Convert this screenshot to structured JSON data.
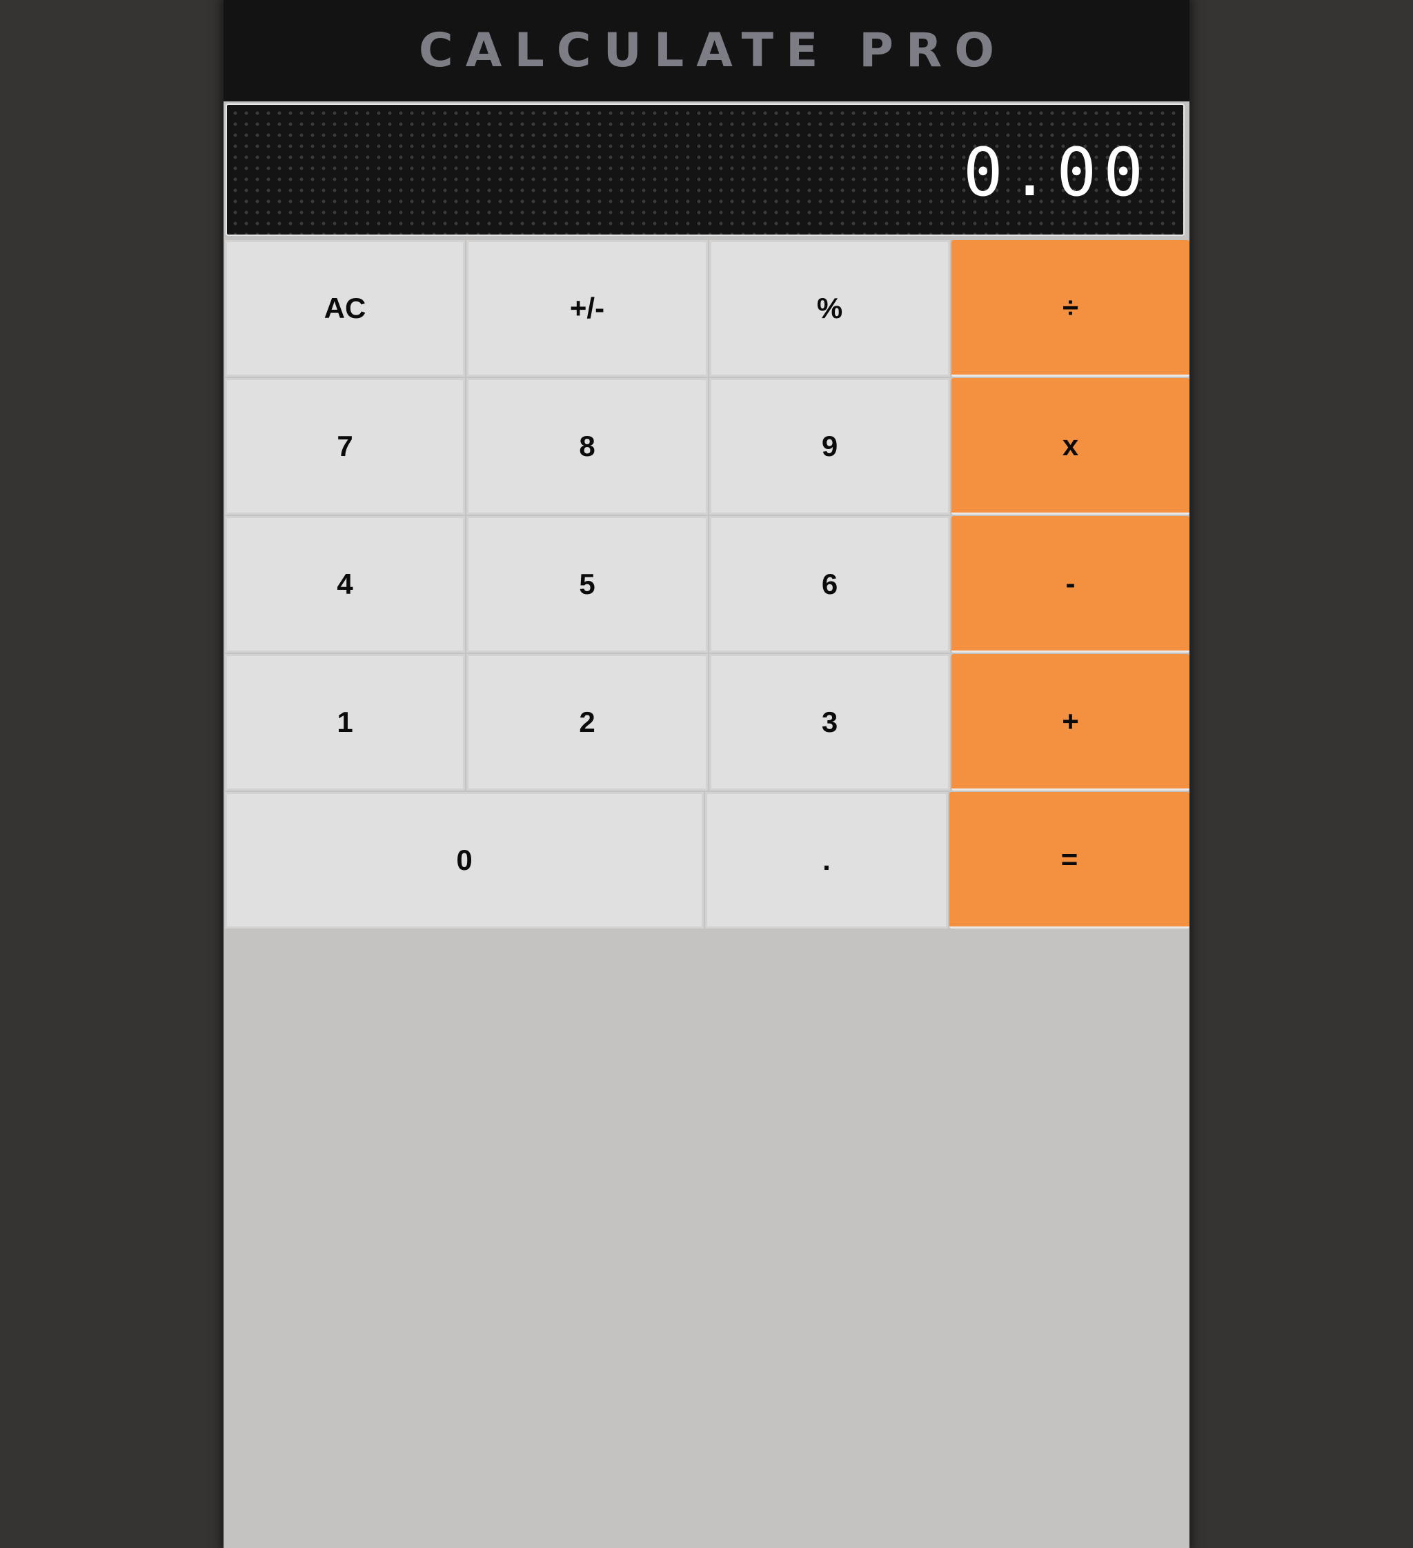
{
  "app": {
    "title": "CALCULATE PRO"
  },
  "display": {
    "value": "0.00"
  },
  "keys": {
    "clear": "AC",
    "sign": "+/-",
    "percent": "%",
    "divide": "÷",
    "seven": "7",
    "eight": "8",
    "nine": "9",
    "multiply": "x",
    "four": "4",
    "five": "5",
    "six": "6",
    "subtract": "-",
    "one": "1",
    "two": "2",
    "three": "3",
    "add": "+",
    "zero": "0",
    "decimal": ".",
    "equals": "="
  },
  "colors": {
    "operator_key": "#f39140",
    "number_key": "#e0e0e0",
    "header_bg": "#131313",
    "title_text": "#7d7d86",
    "display_text": "#ffffff",
    "page_bg": "#353433",
    "app_bg": "#c4c3c1"
  }
}
